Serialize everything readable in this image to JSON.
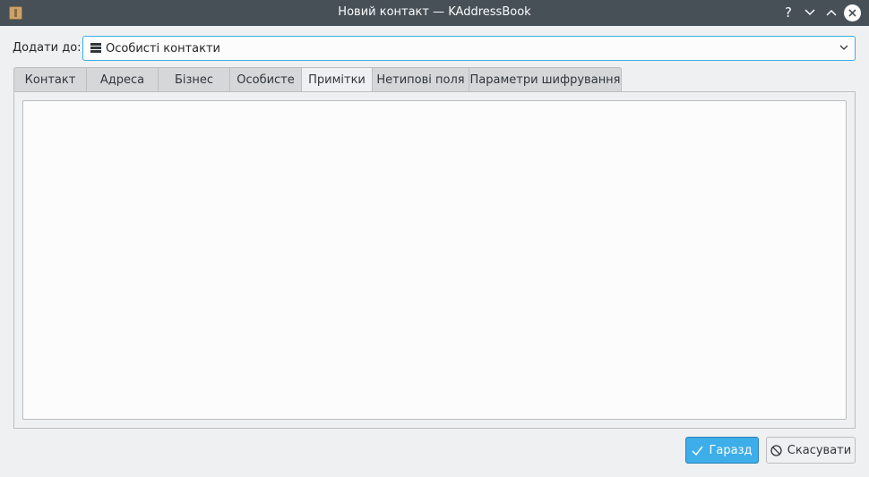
{
  "window": {
    "title": "Новий контакт — KAddressBook",
    "help_glyph": "?",
    "minimize_glyph": "⌄",
    "maximize_glyph": "⌃",
    "close_glyph": "✕"
  },
  "add_to": {
    "label": "Додати до:",
    "selected": "Особисті контакти",
    "icon": "address-book-icon"
  },
  "tabs": [
    {
      "label": "Контакт",
      "active": false
    },
    {
      "label": "Адреса",
      "active": false
    },
    {
      "label": "Бізнес",
      "active": false
    },
    {
      "label": "Особисте",
      "active": false
    },
    {
      "label": "Примітки",
      "active": true
    },
    {
      "label": "Нетипові поля",
      "active": false
    },
    {
      "label": "Параметри шифрування",
      "active": false
    }
  ],
  "notes": {
    "value": ""
  },
  "buttons": {
    "ok_label": "Гаразд",
    "cancel_label": "Скасувати"
  },
  "colors": {
    "titlebar": "#475057",
    "accent": "#3daee9",
    "window_bg": "#eff0f1"
  }
}
